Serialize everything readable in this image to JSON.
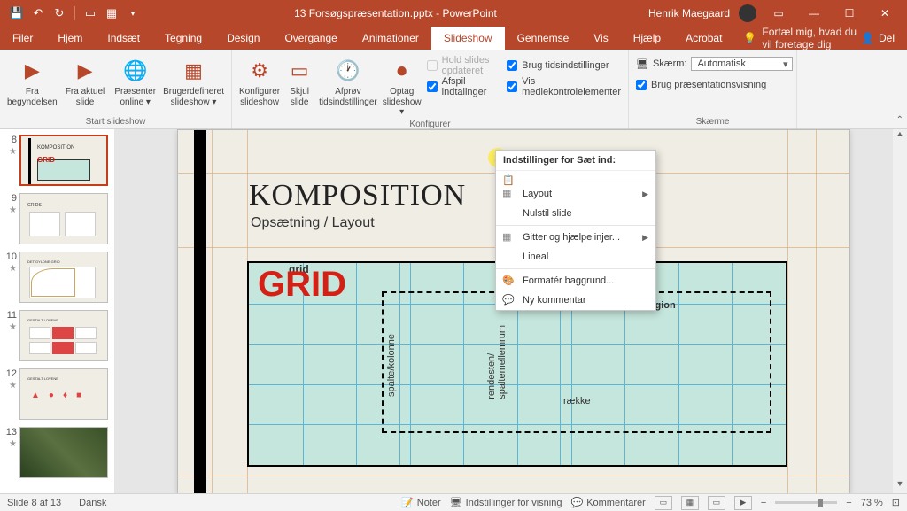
{
  "titlebar": {
    "filename": "13 Forsøgspræsentation.pptx - PowerPoint",
    "username": "Henrik Maegaard"
  },
  "tabs": {
    "filer": "Filer",
    "hjem": "Hjem",
    "indsaet": "Indsæt",
    "tegning": "Tegning",
    "design": "Design",
    "overgange": "Overgange",
    "animationer": "Animationer",
    "slideshow": "Slideshow",
    "gennemse": "Gennemse",
    "vis": "Vis",
    "hjaelp": "Hjælp",
    "acrobat": "Acrobat",
    "tellme": "Fortæl mig, hvad du vil foretage dig",
    "share": "Del"
  },
  "ribbon": {
    "fra_begyndelsen": "Fra\nbegyndelsen",
    "fra_aktuel": "Fra aktuel\nslide",
    "praesenter_online": "Præsenter\nonline ▾",
    "brugerdef": "Brugerdefineret\nslideshow ▾",
    "start_group": "Start slideshow",
    "konfigurer": "Konfigurer\nslideshow",
    "skjul": "Skjul\nslide",
    "afprov": "Afprøv\ntidsindstillinger",
    "optag": "Optag\nslideshow ▾",
    "hold_opdateret": "Hold slides opdateret",
    "brug_tids": "Brug tidsindstillinger",
    "afspil_ind": "Afspil indtalinger",
    "vis_medie": "Vis mediekontrolelementer",
    "konfigurer_group": "Konfigurer",
    "skaerm_lbl": "Skærm:",
    "skaerm_val": "Automatisk",
    "brug_praes": "Brug præsentationsvisning",
    "skaerm_group": "Skærme"
  },
  "thumbs": {
    "n8": "8",
    "n9": "9",
    "n10": "10",
    "n11": "11",
    "n12": "12",
    "n13": "13"
  },
  "slide": {
    "title": "KOMPOSITION",
    "subtitle": "Opsætning / Layout",
    "grid_label": "grid",
    "grid_big": "GRID",
    "spalte": "spalte/kolonne",
    "rendesten": "rendesten/\nspaltemellemrum",
    "zone": "zone/region",
    "raekke": "række"
  },
  "context_menu": {
    "header": "Indstillinger for Sæt ind:",
    "layout": "Layout",
    "nulstil": "Nulstil slide",
    "gitter": "Gitter og hjælpelinjer...",
    "lineal": "Lineal",
    "formater": "Formatér baggrund...",
    "kommentar": "Ny kommentar"
  },
  "statusbar": {
    "slide_info": "Slide 8 af 13",
    "language": "Dansk",
    "noter": "Noter",
    "indstillinger": "Indstillinger for visning",
    "kommentarer": "Kommentarer",
    "zoom": "73 %"
  }
}
